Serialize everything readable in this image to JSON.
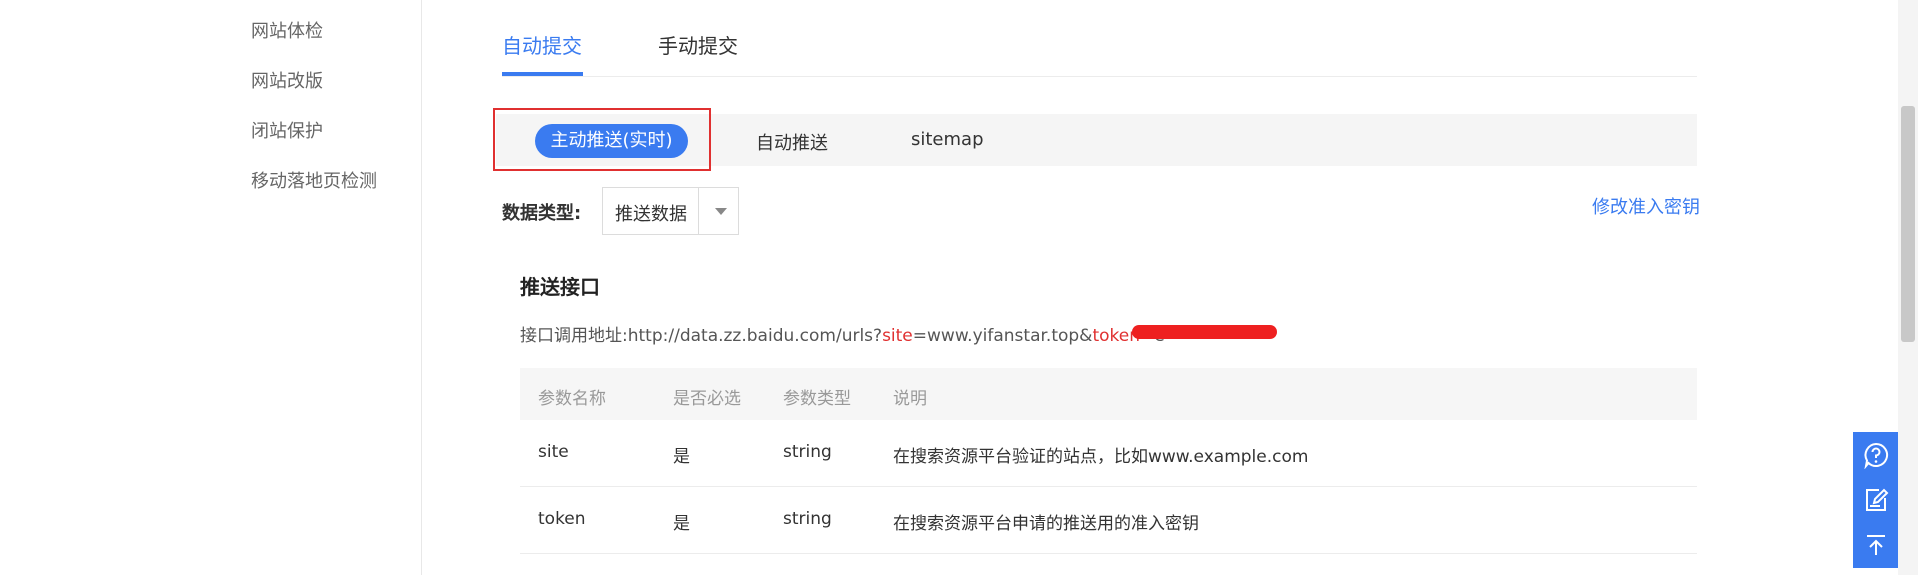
{
  "sidebar": {
    "items": [
      {
        "label": "网站体检"
      },
      {
        "label": "网站改版"
      },
      {
        "label": "闭站保护"
      },
      {
        "label": "移动落地页检测"
      }
    ]
  },
  "tabs": [
    {
      "label": "自动提交",
      "active": true
    },
    {
      "label": "手动提交",
      "active": false
    }
  ],
  "subtabs": [
    {
      "label": "主动推送(实时)",
      "active": true
    },
    {
      "label": "自动推送",
      "active": false
    },
    {
      "label": "sitemap",
      "active": false
    }
  ],
  "data_type": {
    "label": "数据类型:",
    "selected": "推送数据"
  },
  "modify_key_link": "修改准入密钥",
  "push_api": {
    "title": "推送接口",
    "url_label": "接口调用地址:",
    "url_base": "http://data.zz.baidu.com/urls?",
    "param_site": "site",
    "eq1": "=",
    "site_value": "www.yifanstar.top&",
    "param_token": "token",
    "eq2": "=",
    "token_visible": "e"
  },
  "table": {
    "headers": [
      "参数名称",
      "是否必选",
      "参数类型",
      "说明"
    ],
    "rows": [
      [
        "site",
        "是",
        "string",
        "在搜索资源平台验证的站点，比如www.example.com"
      ],
      [
        "token",
        "是",
        "string",
        "在搜索资源平台申请的推送用的准入密钥"
      ]
    ]
  },
  "floating_tools": [
    "help-icon",
    "feedback-edit-icon",
    "back-to-top-icon"
  ],
  "colors": {
    "accent": "#3a7bf0",
    "highlight_red": "#e03030"
  }
}
